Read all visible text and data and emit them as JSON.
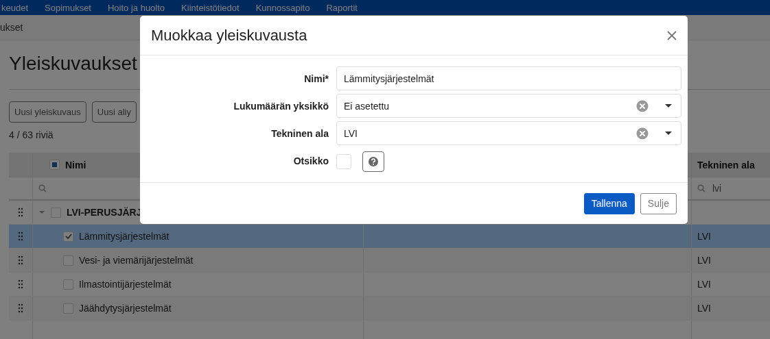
{
  "nav": {
    "items": [
      "keudet",
      "Sopimukset",
      "Hoito ja huolto",
      "Kiinteistötiedot",
      "Kunnossapito",
      "Raportit"
    ]
  },
  "breadcrumb": "ukset",
  "page_title": "Yleiskuvaukset",
  "toolbar": {
    "buttons": [
      "Uusi yleiskuvaus",
      "Uusi aliy"
    ]
  },
  "row_count": "4 / 63 riviä",
  "table": {
    "select_all": {
      "indeterminate": true
    },
    "columns": [
      "Nimi",
      "Tekninen ala"
    ],
    "filters": {
      "tekninen_ala": "lvi"
    },
    "groups": [
      {
        "name": "LVI-PERUSJÄRJ",
        "expanded": true,
        "checked": false,
        "children": [
          {
            "name": "Lämmitysjärjestelmät",
            "checked": true,
            "selected": true,
            "tekninen_ala": "LVI"
          },
          {
            "name": "Vesi- ja viemärijärjestelmät",
            "checked": false,
            "selected": false,
            "tekninen_ala": "LVI"
          },
          {
            "name": "Ilmastointijärjestelmät",
            "checked": false,
            "selected": false,
            "tekninen_ala": "LVI"
          },
          {
            "name": "Jäähdytysjärjestelmät",
            "checked": false,
            "selected": false,
            "tekninen_ala": "LVI"
          }
        ]
      }
    ]
  },
  "modal": {
    "title": "Muokkaa yleiskuvausta",
    "fields": [
      {
        "kind": "text",
        "label": "Nimi*",
        "value": "Lämmitysjärjestelmät"
      },
      {
        "kind": "select",
        "label": "Lukumäärän yksikkö",
        "value": "Ei asetettu"
      },
      {
        "kind": "select",
        "label": "Tekninen ala",
        "value": "LVI"
      },
      {
        "kind": "checkbox",
        "label": "Otsikko",
        "checked": false,
        "help": true
      }
    ],
    "buttons": [
      {
        "label": "Tallenna",
        "primary": true
      },
      {
        "label": "Sulje",
        "primary": false
      }
    ]
  }
}
